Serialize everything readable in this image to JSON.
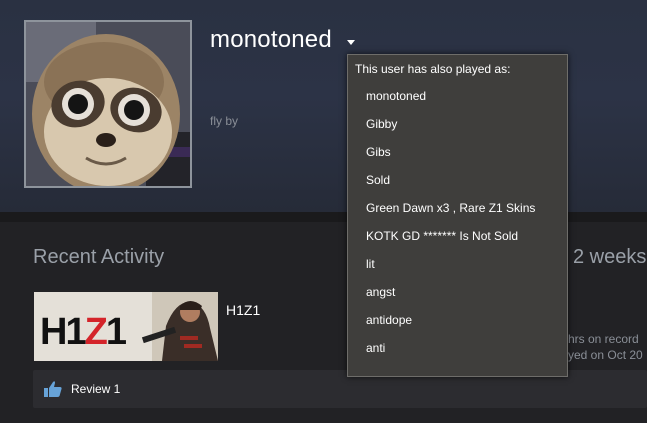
{
  "profile": {
    "username": "monotoned",
    "summary": "fly by"
  },
  "alias_popup": {
    "header": "This user has also played as:",
    "aliases": [
      "monotoned",
      "Gibby",
      "Gibs",
      "Sold",
      "Green Dawn x3 , Rare Z1 Skins",
      "KOTK GD ******* Is Not Sold",
      "lit",
      "angst",
      "antidope",
      "anti"
    ]
  },
  "recent_activity": {
    "title": "Recent Activity",
    "hours_past_weeks": "2 weeks",
    "game": {
      "name": "H1Z1",
      "logo_text": "H1Z1",
      "hours_on_record": "hrs on record",
      "last_played": "yed on Oct 20"
    },
    "review": {
      "label": "Review 1"
    }
  },
  "colors": {
    "header_bg": "#2c3346",
    "page_bg": "#1b1b1d",
    "popup_bg": "#3f3e3c",
    "logo_red": "#d4242a",
    "logo_black": "#111111"
  },
  "icons": [
    "caret-down-icon",
    "thumbs-up-icon"
  ]
}
